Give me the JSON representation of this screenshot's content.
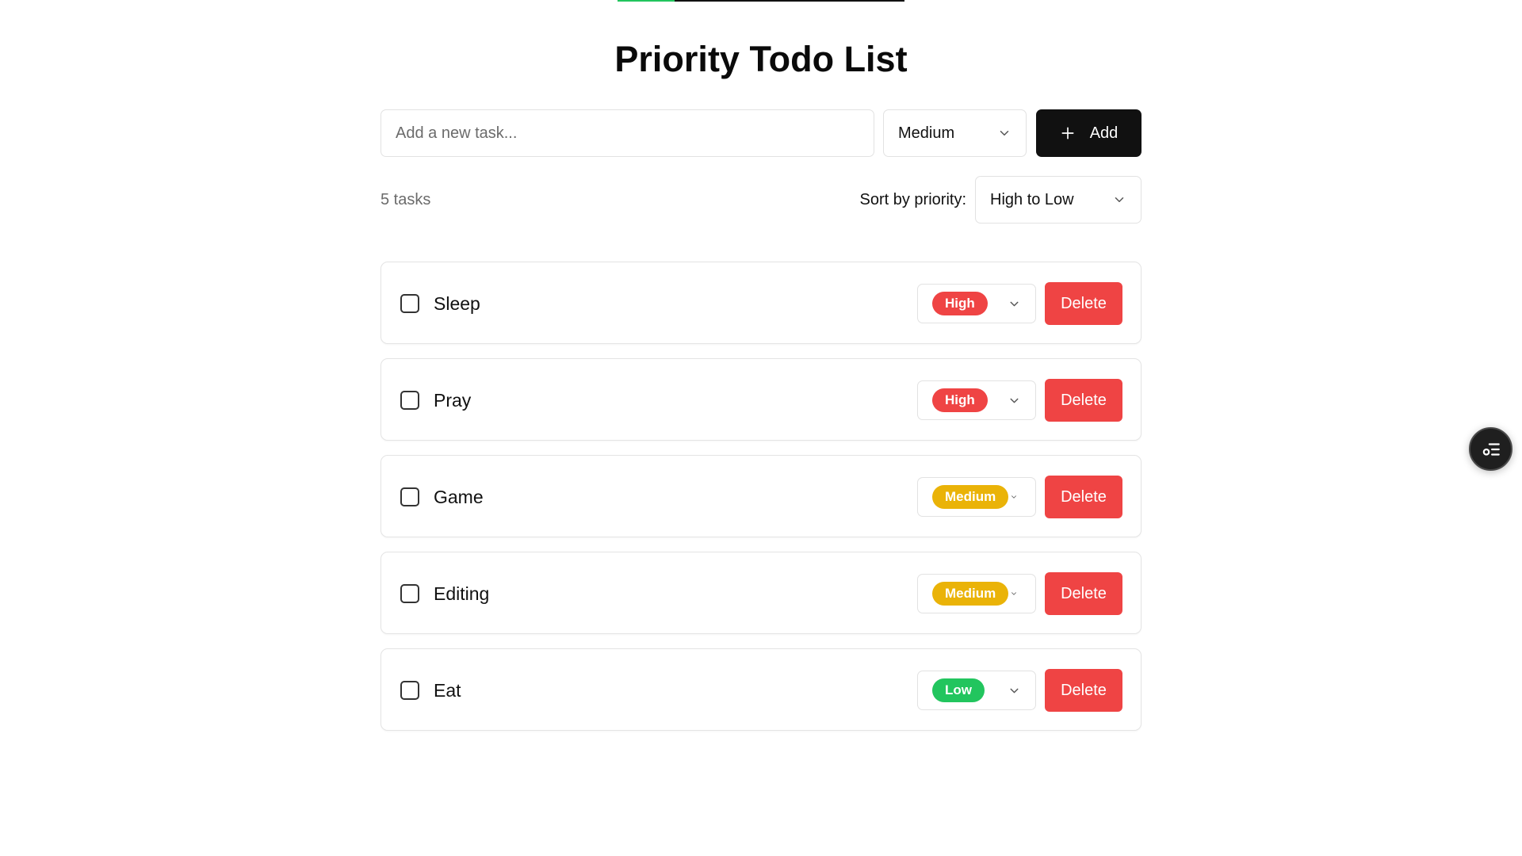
{
  "header": {
    "title": "Priority Todo List",
    "progress": 0.2
  },
  "add_form": {
    "input_value": "",
    "input_placeholder": "Add a new task...",
    "priority_selected": "Medium",
    "add_label": "Add"
  },
  "meta": {
    "task_count": "5 tasks",
    "sort_label": "Sort by priority:",
    "sort_selected": "High to Low"
  },
  "colors": {
    "high": "#ef4444",
    "medium": "#eab308",
    "low": "#22c55e",
    "delete": "#ef4444",
    "add_button": "#111111"
  },
  "icons": {
    "add": "plus-icon",
    "dropdown": "chevron-down-icon",
    "floating": "options-list-icon"
  },
  "tasks": [
    {
      "name": "Sleep",
      "priority": "High",
      "level": "high",
      "done": false,
      "delete_label": "Delete"
    },
    {
      "name": "Pray",
      "priority": "High",
      "level": "high",
      "done": false,
      "delete_label": "Delete"
    },
    {
      "name": "Game",
      "priority": "Medium",
      "level": "medium",
      "done": false,
      "delete_label": "Delete"
    },
    {
      "name": "Editing",
      "priority": "Medium",
      "level": "medium",
      "done": false,
      "delete_label": "Delete"
    },
    {
      "name": "Eat",
      "priority": "Low",
      "level": "low",
      "done": false,
      "delete_label": "Delete"
    }
  ]
}
